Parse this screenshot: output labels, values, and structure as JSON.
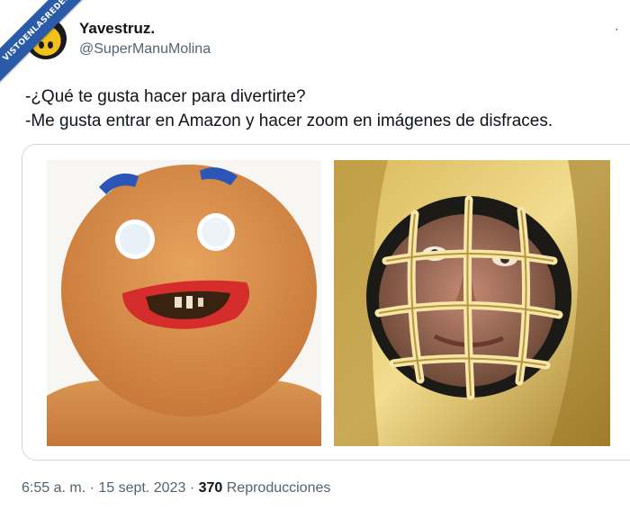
{
  "badge": {
    "text": "VISTOENLASREDES"
  },
  "tweet": {
    "author_name": "Yavestruz.",
    "handle": "@SuperManuMolina",
    "more_icon": "more-dot",
    "lines": [
      "-¿Qué te gusta hacer para divertirte?",
      "-Me gusta entrar en Amazon y hacer zoom en imágenes de disfraces."
    ]
  },
  "media": {
    "left_icon": "gingerbread-costume-photo",
    "right_icon": "gold-costume-face-photo"
  },
  "footer": {
    "time": "6:55 a. m.",
    "sep1": "·",
    "date": "15 sept. 2023",
    "sep2": "·",
    "views_count": "370",
    "views_label": "Reproducciones"
  },
  "colors": {
    "text": "#0f1419",
    "secondary": "#536471",
    "border": "#cfd9de",
    "badge": "#2a5aa8"
  }
}
